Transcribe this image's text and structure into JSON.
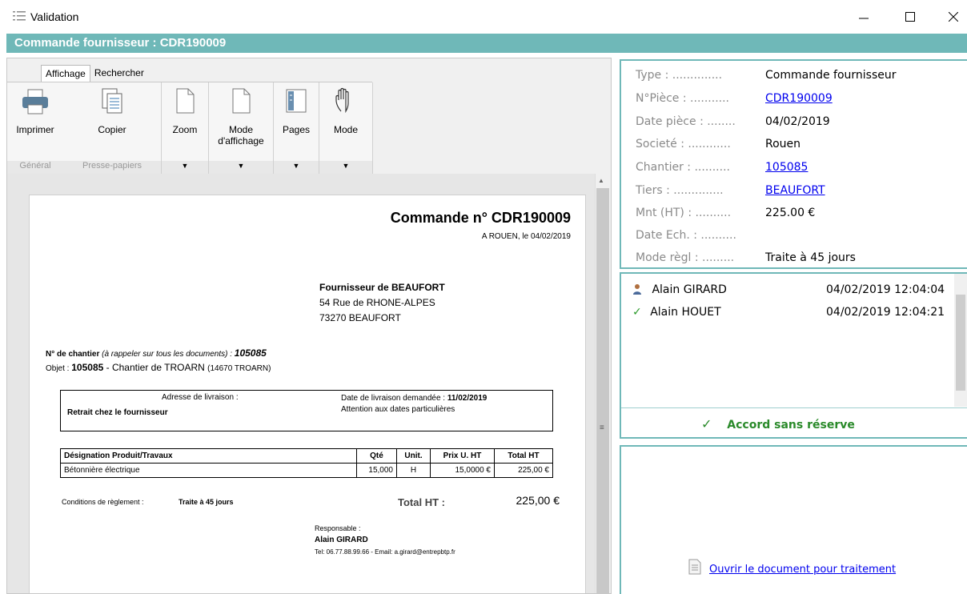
{
  "window": {
    "title": "Validation"
  },
  "header": {
    "title": "Commande fournisseur : CDR190009"
  },
  "tabs": [
    "Affichage",
    "Rechercher"
  ],
  "ribbon": {
    "buttons": {
      "print": "Imprimer",
      "copy": "Copier",
      "zoom": "Zoom",
      "display_mode_1": "Mode",
      "display_mode_2": "d'affichage",
      "pages": "Pages",
      "mode": "Mode"
    },
    "groups": {
      "general": "Général",
      "clipboard": "Presse-papiers"
    }
  },
  "document": {
    "title": "Commande n° CDR190009",
    "place_date": "A ROUEN, le 04/02/2019",
    "supplier_name": "Fournisseur de BEAUFORT",
    "supplier_street": "54 Rue de RHONE-ALPES",
    "supplier_city": "73270 BEAUFORT",
    "site_label": "N° de chantier",
    "site_hint": "(à rappeler sur tous les documents) :",
    "site_number": "105085",
    "object_label": "Objet : ",
    "object_value": "105085",
    "object_desc": " - Chantier de TROARN ",
    "object_zip": "(14670 TROARN)",
    "delivery_address_label": "Adresse de livraison :",
    "delivery_address_value": "Retrait chez le fournisseur",
    "delivery_date_label": "Date de livraison demandée : ",
    "delivery_date_value": "11/02/2019",
    "delivery_note": "Attention aux dates particulières",
    "table_headers": [
      "Désignation Produit/Travaux",
      "Qté",
      "Unit.",
      "Prix U. HT",
      "Total HT"
    ],
    "table_rows": [
      [
        "Bétonnière électrique",
        "15,000",
        "H",
        "15,0000 €",
        "225,00 €"
      ]
    ],
    "payment_label": "Conditions de règlement :",
    "payment_value": "Traite à 45 jours",
    "total_label": "Total HT :",
    "total_value": "225,00 €",
    "manager_label": "Responsable :",
    "manager_name": "Alain GIRARD",
    "manager_contact": "Tel: 06.77.88.99.66 - Email: a.girard@entrepbtp.fr"
  },
  "info": {
    "type_label": "Type : ..............",
    "type_value": "Commande fournisseur",
    "piece_label": "N°Pièce : ...........",
    "piece_value": "CDR190009",
    "date_label": "Date pièce : ........",
    "date_value": "04/02/2019",
    "company_label": "Societé : ............",
    "company_value": "Rouen",
    "site_label": "Chantier : ..........",
    "site_value": "105085",
    "third_label": "Tiers : ..............",
    "third_value": "BEAUFORT",
    "amount_label": "Mnt (HT) : ..........",
    "amount_value": "225.00 €",
    "due_label": "Date Ech. : ..........",
    "payment_label": "Mode règl : .........",
    "payment_value": "Traite à 45 jours"
  },
  "approvals": [
    {
      "name": "Alain GIRARD",
      "datetime": "04/02/2019 12:04:04"
    },
    {
      "name": "Alain HOUET",
      "datetime": "04/02/2019 12:04:21"
    }
  ],
  "status": "Accord sans réserve",
  "action": {
    "open_link": "Ouvrir le document pour traitement"
  },
  "colors": {
    "accent": "#6fb8b8",
    "approve": "#2a8a2a",
    "link": "#0000ee"
  }
}
